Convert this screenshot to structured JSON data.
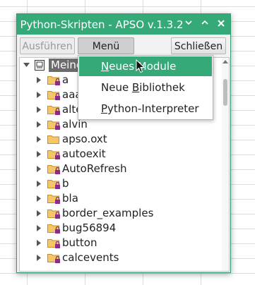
{
  "window": {
    "title": "Python-Skripten - APSO v.1.3.2",
    "accent": "#36a978"
  },
  "toolbar": {
    "run_label": "Ausführen",
    "menu_label": "Menü",
    "close_label": "Schließen"
  },
  "tree": {
    "root_label": "Meine",
    "items": [
      {
        "label": "a",
        "icon": "folder-lock-icon"
      },
      {
        "label": "aaa",
        "icon": "folder-lock-icon"
      },
      {
        "label": "alte",
        "icon": "folder-lock-icon"
      },
      {
        "label": "alvin",
        "icon": "folder-lock-icon"
      },
      {
        "label": "apso.oxt",
        "icon": "folder-icon"
      },
      {
        "label": "autoexit",
        "icon": "folder-lock-icon"
      },
      {
        "label": "AutoRefresh",
        "icon": "folder-lock-icon"
      },
      {
        "label": "b",
        "icon": "folder-lock-icon"
      },
      {
        "label": "bla",
        "icon": "folder-lock-icon"
      },
      {
        "label": "border_examples",
        "icon": "folder-lock-icon"
      },
      {
        "label": "bug56894",
        "icon": "folder-lock-icon"
      },
      {
        "label": "button",
        "icon": "folder-lock-icon"
      },
      {
        "label": "calcevents",
        "icon": "folder-lock-icon"
      }
    ]
  },
  "menu": {
    "items": [
      {
        "pre": "",
        "mn": "N",
        "post": "eues Modul",
        "tail": "e"
      },
      {
        "pre": "Neue ",
        "mn": "B",
        "post": "ibliothek",
        "tail": ""
      },
      {
        "pre": "",
        "mn": "P",
        "post": "ython-Interpreter",
        "tail": ""
      }
    ]
  }
}
